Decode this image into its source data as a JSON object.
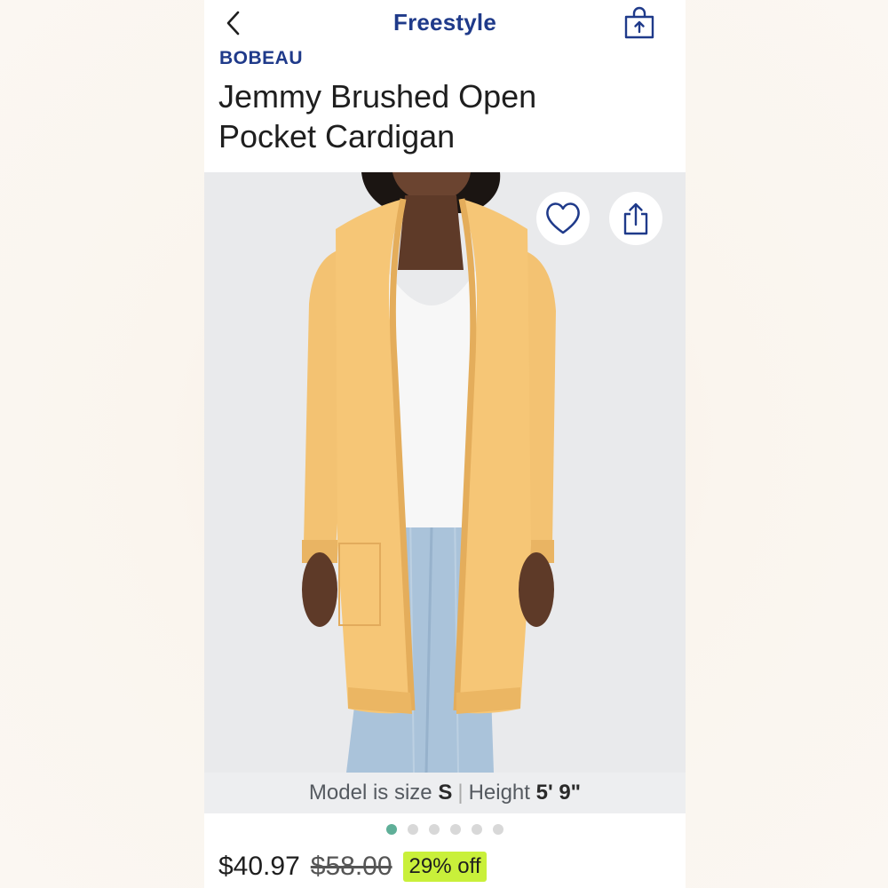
{
  "header": {
    "app_title": "Freestyle",
    "back_icon": "chevron-left-icon",
    "bag_icon": "shopping-bag-icon"
  },
  "product": {
    "brand": "BOBEAU",
    "title_line1": "Jemmy Brushed Open",
    "title_line2": "Pocket Cardigan",
    "model_info": {
      "prefix": "Model is size",
      "size": "S",
      "height_label": "Height",
      "height": "5' 9\""
    },
    "image_count": 6,
    "active_image_index": 0,
    "price": {
      "current": "$40.97",
      "original": "$58.00",
      "discount": "29% off"
    }
  },
  "actions": {
    "favorite_icon": "heart-icon",
    "share_icon": "share-icon"
  },
  "colors": {
    "brand_blue": "#1f3a8a",
    "cardigan_yellow": "#f6c676",
    "dot_active": "#5faf98",
    "discount_badge": "#c9f03a"
  }
}
